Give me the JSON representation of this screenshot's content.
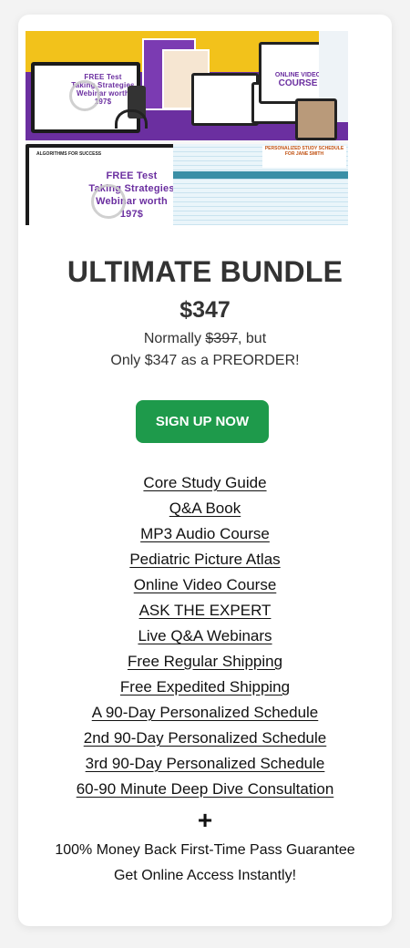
{
  "hero": {
    "webinar_title": "FREE Test Taking Strategies Webinar worth 197$",
    "webinar_title_small": "FREE Test Taking Strategies Webinar worth 197$",
    "algorithms_label": "ALGORITHMS FOR SUCCESS",
    "course_line1": "ONLINE VIDEO",
    "course_line2": "COURSE",
    "schedule_label": "PERSONALIZED STUDY SCHEDULE FOR JANE SMITH"
  },
  "product": {
    "title": "ULTIMATE BUNDLE",
    "price": "$347",
    "normally_prefix": "Normally ",
    "old_price": "$397",
    "normally_suffix": ", but",
    "preorder_text": "Only $347 as a PREORDER!"
  },
  "cta": {
    "label": "SIGN UP NOW",
    "color": "#1e9a4b"
  },
  "features": [
    "Core Study Guide",
    "Q&A Book",
    "MP3 Audio Course ",
    "Pediatric Picture Atlas",
    "Online Video Course",
    "ASK THE EXPERT",
    "Live Q&A Webinars",
    "Free Regular Shipping",
    "Free Expedited Shipping",
    "A 90-Day Personalized Schedule",
    "2nd 90-Day Personalized Schedule",
    "3rd 90-Day Personalized Schedule",
    "60-90 Minute Deep Dive Consultation"
  ],
  "plus": "+",
  "guarantee": "100% Money Back First-Time Pass Guarantee",
  "access": "Get Online Access Instantly!",
  "colors": {
    "accent": "#1e9a4b",
    "brand_purple": "#6b2fa0",
    "brand_yellow": "#f2c21b"
  }
}
